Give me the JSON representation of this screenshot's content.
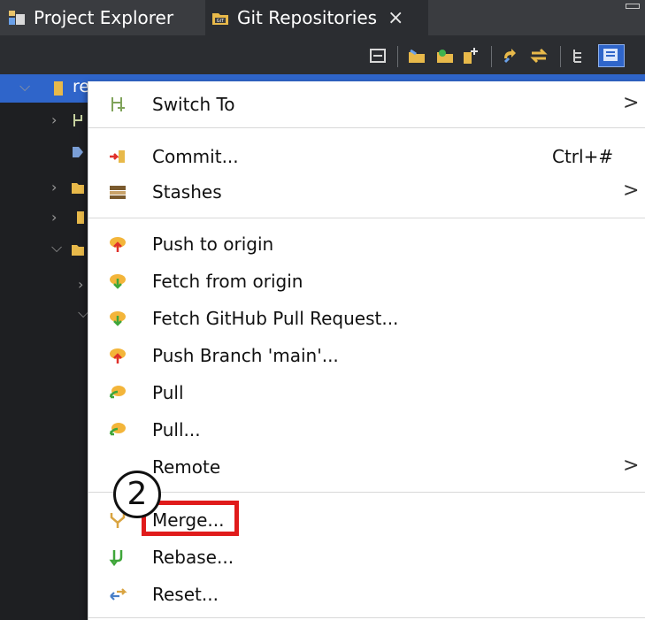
{
  "tabs": {
    "project_explorer": "Project Explorer",
    "git_repositories": "Git Repositories",
    "close_glyph": "×"
  },
  "repo_row": {
    "label_prefix": "re"
  },
  "menu": {
    "items": [
      {
        "label": "Switch To",
        "arrow": ">"
      },
      {
        "label": "Commit...",
        "shortcut": "Ctrl+#"
      },
      {
        "label": "Stashes",
        "arrow": ">"
      },
      {
        "label": "Push to origin"
      },
      {
        "label": "Fetch from origin"
      },
      {
        "label": "Fetch GitHub Pull Request..."
      },
      {
        "label": "Push Branch 'main'..."
      },
      {
        "label": "Pull"
      },
      {
        "label": "Pull..."
      },
      {
        "label": "Remote",
        "arrow": ">"
      },
      {
        "label": "Merge..."
      },
      {
        "label": "Rebase..."
      },
      {
        "label": "Reset..."
      }
    ]
  },
  "annotation": {
    "step_number": "2",
    "highlight_color": "#e01b1b"
  },
  "colors": {
    "dark_background": "#1e1f22",
    "menu_background": "#ffffff",
    "selection_blue": "#2f65ca"
  }
}
